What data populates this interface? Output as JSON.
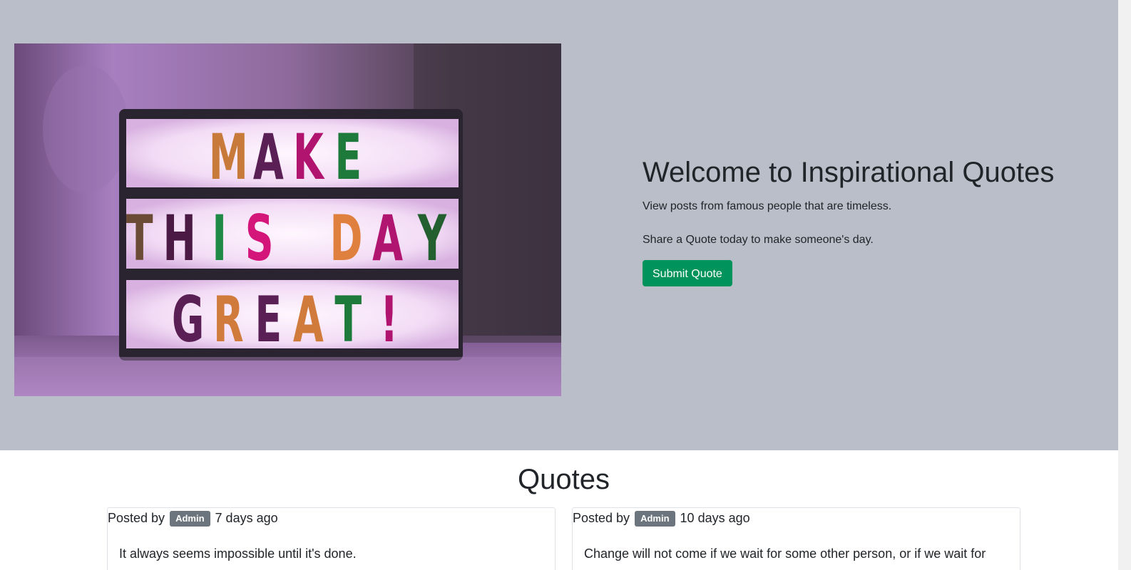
{
  "hero": {
    "image_sign": {
      "line1": [
        "M",
        "A",
        "K",
        "E"
      ],
      "line2": [
        "T",
        "H",
        "I",
        "S",
        "D",
        "A",
        "Y"
      ],
      "line3": [
        "G",
        "R",
        "E",
        "A",
        "T",
        "!"
      ]
    },
    "title": "Welcome to Inspirational Quotes",
    "lead": "View posts from famous people that are timeless.",
    "lead2": "Share a Quote today to make someone's day.",
    "submit_label": "Submit Quote"
  },
  "quotes": {
    "title": "Quotes",
    "posted_by_label": "Posted by",
    "cards": [
      {
        "author_badge": "Admin",
        "time": "7 days ago",
        "text": "It always seems impossible until it's done."
      },
      {
        "author_badge": "Admin",
        "time": "10 days ago",
        "text": "Change will not come if we wait for some other person, or if we wait for"
      }
    ]
  },
  "colors": {
    "hero_bg": "#babec8",
    "accent_green": "#00935b",
    "badge_gray": "#6c757d"
  }
}
